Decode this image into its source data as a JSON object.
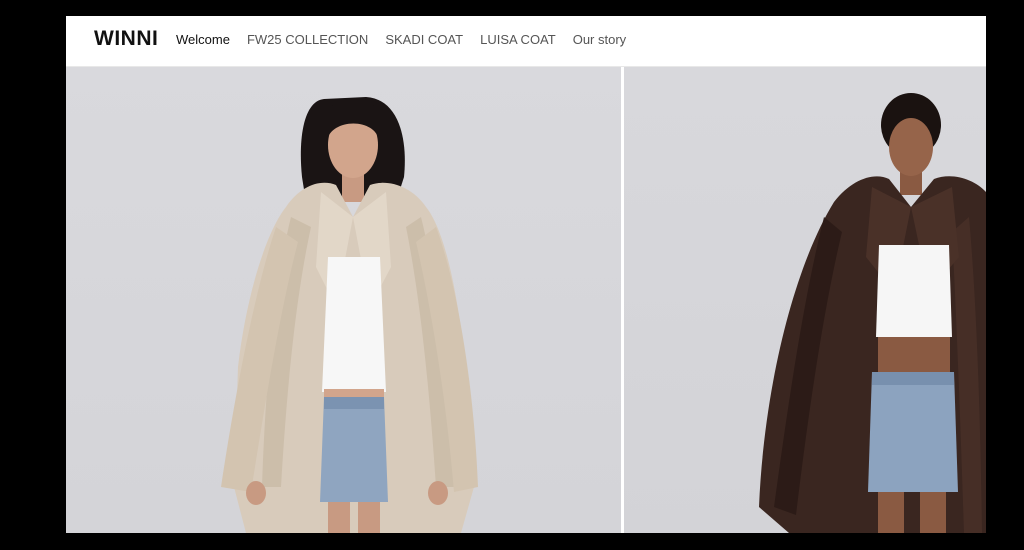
{
  "brand": {
    "name": "WINNI"
  },
  "nav": {
    "items": [
      {
        "label": "Welcome",
        "active": true
      },
      {
        "label": "FW25 COLLECTION",
        "active": false
      },
      {
        "label": "SKADI COAT",
        "active": false
      },
      {
        "label": "LUISA COAT",
        "active": false
      },
      {
        "label": "Our story",
        "active": false
      }
    ]
  },
  "gallery": {
    "photos": [
      {
        "subject": "model in cream faux fur coat, white tank top, denim mini skirt",
        "coat_color": "#d8cbbb"
      },
      {
        "subject": "model in dark brown faux fur coat, white tank top, denim mini skirt",
        "coat_color": "#3a2620"
      }
    ]
  },
  "colors": {
    "page_bg": "#000000",
    "header_bg": "#ffffff",
    "photo_bg": "#d7d7db"
  }
}
